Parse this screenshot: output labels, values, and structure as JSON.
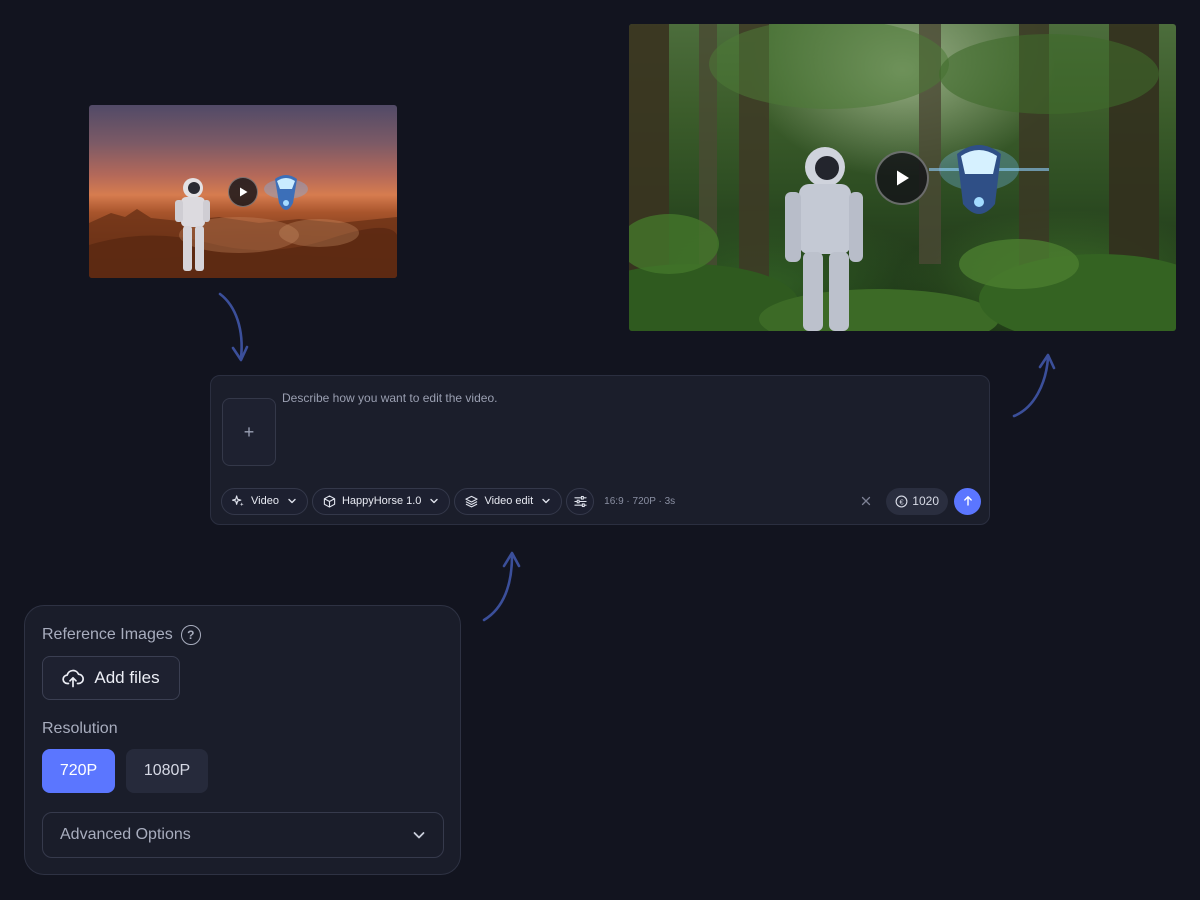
{
  "source_video": {
    "play_icon": "play-icon"
  },
  "result_video": {
    "play_icon": "play-icon"
  },
  "composer": {
    "add_icon": "+",
    "prompt_placeholder": "Describe how you want to edit the video.",
    "mode_label": "Video",
    "model_label": "HappyHorse 1.0",
    "task_label": "Video edit",
    "settings_summary": "16:9 · 720P · 3s",
    "credit_symbol": "€",
    "credits": "1020"
  },
  "panel": {
    "reference_title": "Reference Images",
    "help_glyph": "?",
    "add_files_label": "Add files",
    "resolution_label": "Resolution",
    "resolution_options": [
      "720P",
      "1080P"
    ],
    "resolution_selected": "720P",
    "advanced_label": "Advanced Options"
  },
  "colors": {
    "background": "#12141f",
    "accent": "#5b76ff",
    "arrow": "#3b4f9a"
  }
}
